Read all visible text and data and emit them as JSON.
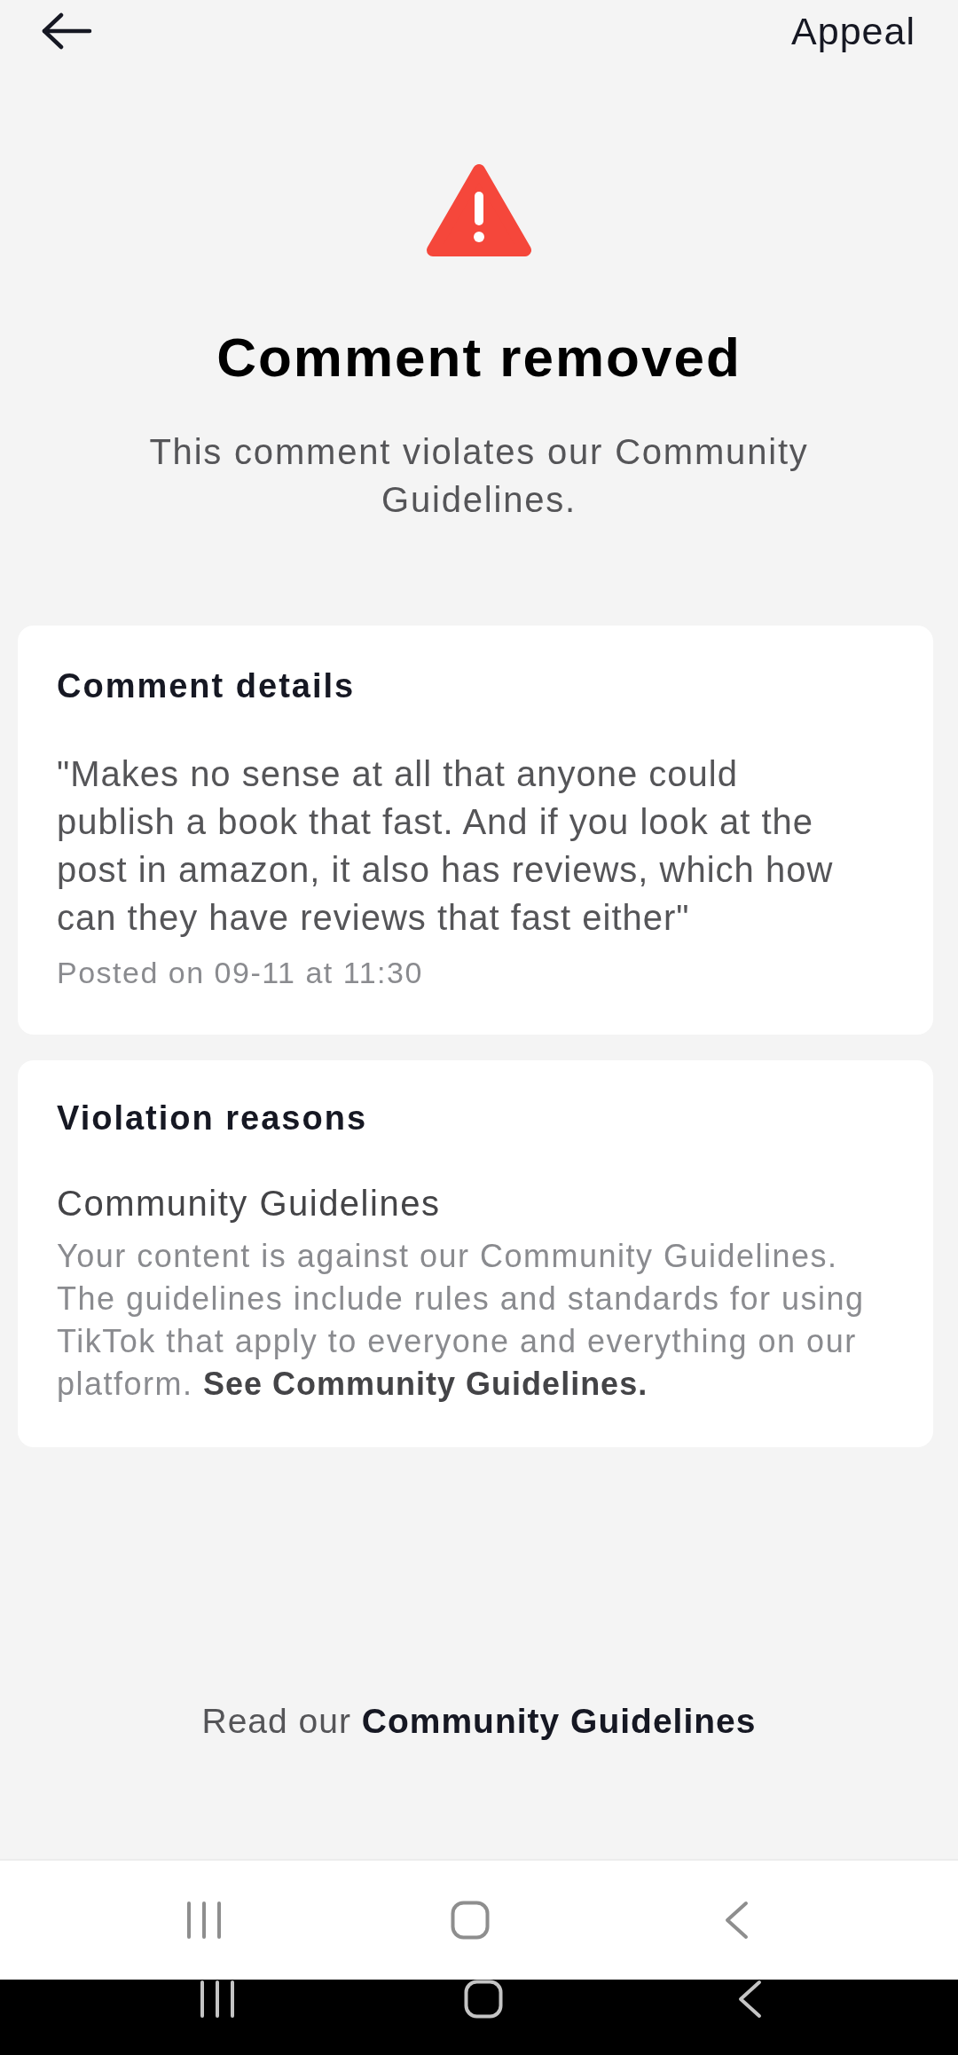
{
  "top_bar": {
    "action": "Appeal"
  },
  "notice": {
    "title": "Comment removed",
    "message": "This comment violates our Community Guidelines."
  },
  "comment_card": {
    "heading": "Comment details",
    "text": "\"Makes no sense at all that anyone could publish a book that fast. And if you look at the post in amazon, it also has reviews, which how can they have reviews that fast either\"",
    "posted": "Posted on 09-11 at 11:30"
  },
  "violation_card": {
    "heading": "Violation reasons",
    "reasons": [
      {
        "title": "Community Guidelines",
        "description": "Your content is against our Community Guidelines. The guidelines include rules and standards for using TikTok that apply to everyone and everything on our platform.",
        "link": "See Community Guidelines."
      }
    ]
  },
  "footer": {
    "prefix": "Read our",
    "link": "Community Guidelines"
  }
}
